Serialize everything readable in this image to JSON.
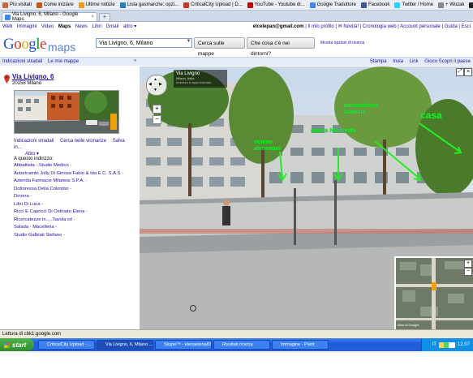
{
  "bookmarks": [
    {
      "label": "Più visitati",
      "color": "#cc6633"
    },
    {
      "label": "Come iniziare",
      "color": "#d35400"
    },
    {
      "label": "Ultime notizie",
      "color": "#f39c12"
    },
    {
      "label": "Lista gasmarche: opzi...",
      "color": "#2980b9"
    },
    {
      "label": "CriticalCity Upload | D...",
      "color": "#c0392b"
    },
    {
      "label": "YouTube - Youtube di...",
      "color": "#cc0000"
    },
    {
      "label": "Google Traduttore",
      "color": "#4285f4"
    },
    {
      "label": "Facebook",
      "color": "#3b5998"
    },
    {
      "label": "Twitter / Home",
      "color": "#33ccff"
    },
    {
      "label": "+ Wozak",
      "color": "#888888"
    },
    {
      "label": "La Repubblica.it - Hom...",
      "color": "#222222"
    }
  ],
  "browser": {
    "tab_title": "Via Livigno, 6, Milano - Google Maps",
    "new_tab": "+"
  },
  "gnav": {
    "left": [
      "Web",
      "Immagini",
      "Video"
    ],
    "active": "Maps",
    "left2": [
      "News",
      "Libri",
      "Gmail",
      "altro ▾"
    ],
    "email": "elcelepan@gmail.com",
    "right": "| Il mio profilo | ✉ Novità! | Cronologia web | Account personale | Guida | Esci"
  },
  "header": {
    "logo_google": "Google",
    "logo_maps": "maps",
    "search_value": "Via Livigno, 6, Milano",
    "btn_search": "Cerca sulle mappe",
    "btn_near": "Che cosa c'è nei dintorni?",
    "adv_link": "Mostra opzioni di ricerca"
  },
  "subbar": {
    "left": [
      "Indicazioni stradali",
      "Le mie mappe"
    ],
    "right": [
      "Stampa",
      "Invia",
      "Link",
      "Gioco Scopri il paese"
    ]
  },
  "side": {
    "title": "Via Livigno, 6",
    "city": "20158 Milano",
    "actions": [
      "Indicazioni stradali",
      "Cerca nelle vicinanze",
      "Salva in...",
      "Altro ▾"
    ],
    "addr_header": "A questo indirizzo:",
    "addresses": [
      "Abbattista - Studio Medico",
      "Autoricambi Jolly Di Ginosa Fabio & Ida E C. S.A.S",
      "Azienda Farmacie Milanesi S.P.A.",
      "Dottoressa Delia Colombo",
      "Dovera",
      "Libri Di Luna",
      "Ricci E Capricci Di Ostinato Elena",
      "Ricercatezze in.....Tavola srl",
      "Salada - Macelleria",
      "Studio Galbiati Stefano"
    ]
  },
  "map": {
    "sv_title": "Via Livigno",
    "sv_sub": "Milano, Italia",
    "sv_sub2": "Indirizzo è approssimato",
    "annotations": [
      "ricamo alimentari",
      "parrucchiera mamma",
      "amica Nicoletta",
      "casa"
    ],
    "minimap_label": "Altro di Google"
  },
  "status": "Lettura di cbk1.google.com",
  "taskbar": {
    "start": "start",
    "tasks": [
      "CriticalCity Upload - ...",
      "Via Livigno, 6, Milano ...",
      "Skype™ - elenaelena83",
      "Risultati ricerca",
      "Immagine - Paint"
    ],
    "lang": "IT",
    "clock": "12.07"
  }
}
